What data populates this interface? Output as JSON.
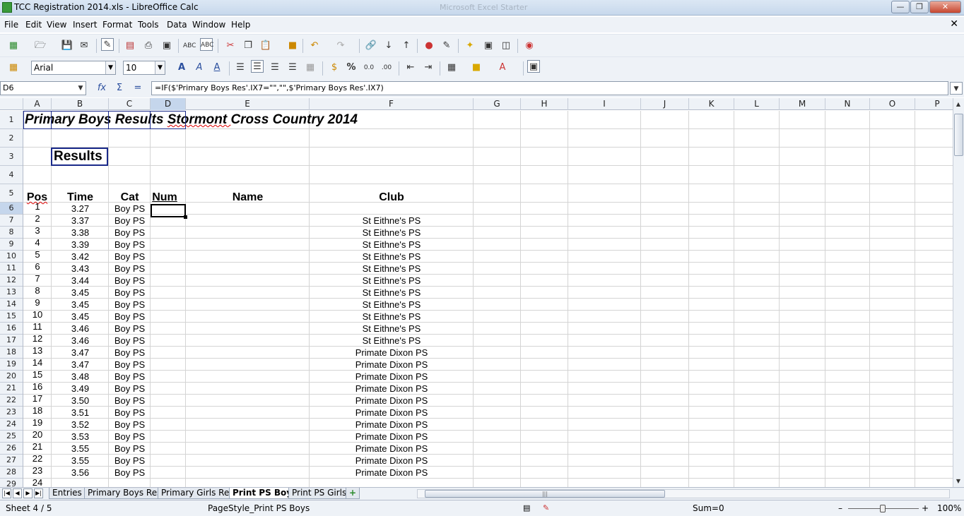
{
  "window": {
    "title": "TCC Registration 2014.xls - LibreOffice Calc",
    "background_title": "Microsoft Excel Starter"
  },
  "menu": [
    "File",
    "Edit",
    "View",
    "Insert",
    "Format",
    "Tools",
    "Data",
    "Window",
    "Help"
  ],
  "format_toolbar": {
    "font_name": "Arial",
    "font_size": "10"
  },
  "formula_bar": {
    "cell_ref": "D6",
    "formula": "=IF($'Primary Boys Res'.IX7=\"\",\"\",$'Primary Boys Res'.IX7)"
  },
  "columns": [
    "A",
    "B",
    "C",
    "D",
    "E",
    "F",
    "G",
    "H",
    "I",
    "J",
    "K",
    "L",
    "M",
    "N",
    "O",
    "P"
  ],
  "selected_column": "D",
  "rows": [
    "1",
    "2",
    "3",
    "4",
    "5",
    "6",
    "7",
    "8",
    "9",
    "10",
    "11",
    "12",
    "13",
    "14",
    "15",
    "16",
    "17",
    "18",
    "19",
    "20",
    "21",
    "22",
    "23",
    "24",
    "25",
    "26",
    "27",
    "28",
    "29"
  ],
  "selected_row": "6",
  "sheet": {
    "title": "Primary Boys Results Stormont Cross Country 2014",
    "subtitle": "Results",
    "headers": {
      "pos": "Pos",
      "time": "Time",
      "cat": "Cat",
      "num": "Num",
      "name": "Name",
      "club": "Club"
    },
    "results": [
      {
        "pos": "1",
        "time": "3.27",
        "cat": "Boy PS",
        "club": ""
      },
      {
        "pos": "2",
        "time": "3.37",
        "cat": "Boy PS",
        "club": "St Eithne's PS"
      },
      {
        "pos": "3",
        "time": "3.38",
        "cat": "Boy PS",
        "club": "St Eithne's PS"
      },
      {
        "pos": "4",
        "time": "3.39",
        "cat": "Boy PS",
        "club": "St Eithne's PS"
      },
      {
        "pos": "5",
        "time": "3.42",
        "cat": "Boy PS",
        "club": "St Eithne's PS"
      },
      {
        "pos": "6",
        "time": "3.43",
        "cat": "Boy PS",
        "club": "St Eithne's PS"
      },
      {
        "pos": "7",
        "time": "3.44",
        "cat": "Boy PS",
        "club": "St Eithne's PS"
      },
      {
        "pos": "8",
        "time": "3.45",
        "cat": "Boy PS",
        "club": "St Eithne's PS"
      },
      {
        "pos": "9",
        "time": "3.45",
        "cat": "Boy PS",
        "club": "St Eithne's PS"
      },
      {
        "pos": "10",
        "time": "3.45",
        "cat": "Boy PS",
        "club": "St Eithne's PS"
      },
      {
        "pos": "11",
        "time": "3.46",
        "cat": "Boy PS",
        "club": "St Eithne's PS"
      },
      {
        "pos": "12",
        "time": "3.46",
        "cat": "Boy PS",
        "club": "St Eithne's PS"
      },
      {
        "pos": "13",
        "time": "3.47",
        "cat": "Boy PS",
        "club": "Primate Dixon PS"
      },
      {
        "pos": "14",
        "time": "3.47",
        "cat": "Boy PS",
        "club": "Primate Dixon PS"
      },
      {
        "pos": "15",
        "time": "3.48",
        "cat": "Boy PS",
        "club": "Primate Dixon PS"
      },
      {
        "pos": "16",
        "time": "3.49",
        "cat": "Boy PS",
        "club": "Primate Dixon PS"
      },
      {
        "pos": "17",
        "time": "3.50",
        "cat": "Boy PS",
        "club": "Primate Dixon PS"
      },
      {
        "pos": "18",
        "time": "3.51",
        "cat": "Boy PS",
        "club": "Primate Dixon PS"
      },
      {
        "pos": "19",
        "time": "3.52",
        "cat": "Boy PS",
        "club": "Primate Dixon PS"
      },
      {
        "pos": "20",
        "time": "3.53",
        "cat": "Boy PS",
        "club": "Primate Dixon PS"
      },
      {
        "pos": "21",
        "time": "3.55",
        "cat": "Boy PS",
        "club": "Primate Dixon PS"
      },
      {
        "pos": "22",
        "time": "3.55",
        "cat": "Boy PS",
        "club": "Primate Dixon PS"
      },
      {
        "pos": "23",
        "time": "3.56",
        "cat": "Boy PS",
        "club": "Primate Dixon PS"
      },
      {
        "pos": "24",
        "time": "",
        "cat": "",
        "club": ""
      }
    ]
  },
  "sheet_tabs": [
    "Entries",
    "Primary Boys Res",
    "Primary Girls Res",
    "Print PS Boys",
    "Print PS Girls"
  ],
  "active_tab": "Print PS Boys",
  "status": {
    "sheet": "Sheet 4 / 5",
    "page_style": "PageStyle_Print PS Boys",
    "sum": "Sum=0",
    "zoom": "100%"
  }
}
